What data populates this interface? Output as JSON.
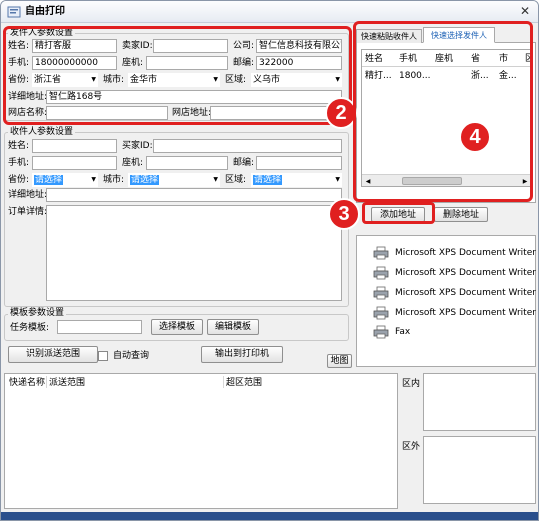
{
  "window": {
    "title": "自由打印",
    "close_glyph": "✕"
  },
  "sender": {
    "group_title": "发件人参数设置",
    "name_label": "姓名:",
    "name_value": "精打客服",
    "seller_id_label": "卖家ID:",
    "seller_id_value": "",
    "company_label": "公司:",
    "company_value": "智仁信息科技有限公司",
    "mobile_label": "手机:",
    "mobile_value": "18000000000",
    "phone_label": "座机:",
    "phone_value": "",
    "zip_label": "邮编:",
    "zip_value": "322000",
    "province_label": "省份:",
    "province_value": "浙江省",
    "city_label": "城市:",
    "city_value": "金华市",
    "district_label": "区域:",
    "district_value": "义乌市",
    "address_label": "详细地址:",
    "address_value": "智仁路168号",
    "shop_name_label": "网店名称:",
    "shop_name_value": "",
    "shop_url_label": "网店地址:",
    "shop_url_value": ""
  },
  "receiver": {
    "group_title": "收件人参数设置",
    "name_label": "姓名:",
    "buyer_id_label": "买家ID:",
    "mobile_label": "手机:",
    "phone_label": "座机:",
    "zip_label": "邮编:",
    "province_label": "省份:",
    "province_value": "请选择",
    "city_label": "城市:",
    "city_value": "请选择",
    "district_label": "区域:",
    "district_value": "请选择",
    "address_label": "详细地址:",
    "order_detail_label": "订单详情:"
  },
  "template": {
    "group_title": "模板参数设置",
    "task_template_label": "任务模板:",
    "select_button": "选择模板",
    "edit_button": "编辑模板"
  },
  "actions": {
    "identify_button": "识别派送范围",
    "auto_query_label": "自动查询",
    "print_button": "输出到打印机",
    "map_button": "地图"
  },
  "result": {
    "columns": [
      "快递名称",
      "派送范围",
      "超区范围"
    ],
    "inside_label": "区内",
    "outside_label": "区外"
  },
  "tabs": {
    "items": [
      "快速粘贴收件人",
      "快速选择发件人"
    ],
    "active": 1
  },
  "sender_table": {
    "columns": [
      "姓名",
      "手机",
      "座机",
      "省",
      "市",
      "区"
    ],
    "rows": [
      [
        "精打...",
        "1800...",
        "",
        "浙...",
        "金...",
        ""
      ]
    ]
  },
  "address_buttons": {
    "add": "添加地址",
    "delete": "删除地址"
  },
  "printers": [
    "Microsoft XPS Document Writer P",
    "Microsoft XPS Document Writer P",
    "Microsoft XPS Document Writer P",
    "Microsoft XPS Document Writer",
    "Fax"
  ],
  "annotations": {
    "two": "2",
    "three": "3",
    "four": "4"
  },
  "colors": {
    "annotation_red": "#e02020",
    "selection_blue": "#3399ff",
    "tab_active_text": "#1a5fb4"
  }
}
